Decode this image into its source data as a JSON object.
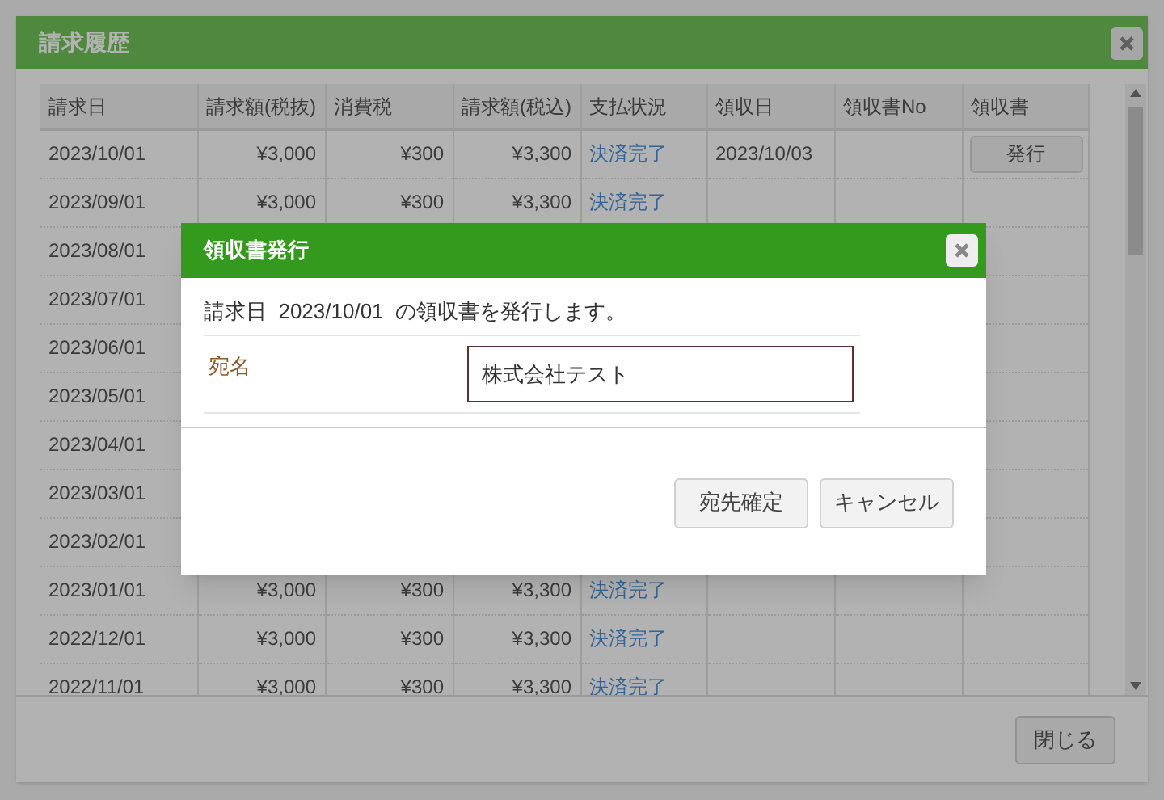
{
  "window": {
    "title": "請求履歴"
  },
  "table": {
    "columns": [
      "請求日",
      "請求額(税抜)",
      "消費税",
      "請求額(税込)",
      "支払状況",
      "領収日",
      "領収書No",
      "領収書"
    ],
    "rows": [
      {
        "date": "2023/10/01",
        "amount_ex": "¥3,000",
        "tax": "¥300",
        "amount_in": "¥3,300",
        "status": "決済完了",
        "received": "2023/10/03",
        "button": "発行"
      },
      {
        "date": "2023/09/01",
        "amount_ex": "¥3,000",
        "tax": "¥300",
        "amount_in": "¥3,300",
        "status": "決済完了"
      },
      {
        "date": "2023/08/01"
      },
      {
        "date": "2023/07/01"
      },
      {
        "date": "2023/06/01"
      },
      {
        "date": "2023/05/01"
      },
      {
        "date": "2023/04/01"
      },
      {
        "date": "2023/03/01"
      },
      {
        "date": "2023/02/01"
      },
      {
        "date": "2023/01/01",
        "amount_ex": "¥3,000",
        "tax": "¥300",
        "amount_in": "¥3,300",
        "status": "決済完了"
      },
      {
        "date": "2022/12/01",
        "amount_ex": "¥3,000",
        "tax": "¥300",
        "amount_in": "¥3,300",
        "status": "決済完了"
      },
      {
        "date": "2022/11/01",
        "amount_ex": "¥3,000",
        "tax": "¥300",
        "amount_in": "¥3,300",
        "status": "決済完了"
      }
    ]
  },
  "footer": {
    "close_button": "閉じる"
  },
  "dialog": {
    "title": "領収書発行",
    "message": "請求日  2023/10/01  の領収書を発行します。",
    "field": {
      "label": "宛名",
      "value": "株式会社テスト"
    },
    "buttons": [
      "宛先確定",
      "キャンセル"
    ]
  }
}
